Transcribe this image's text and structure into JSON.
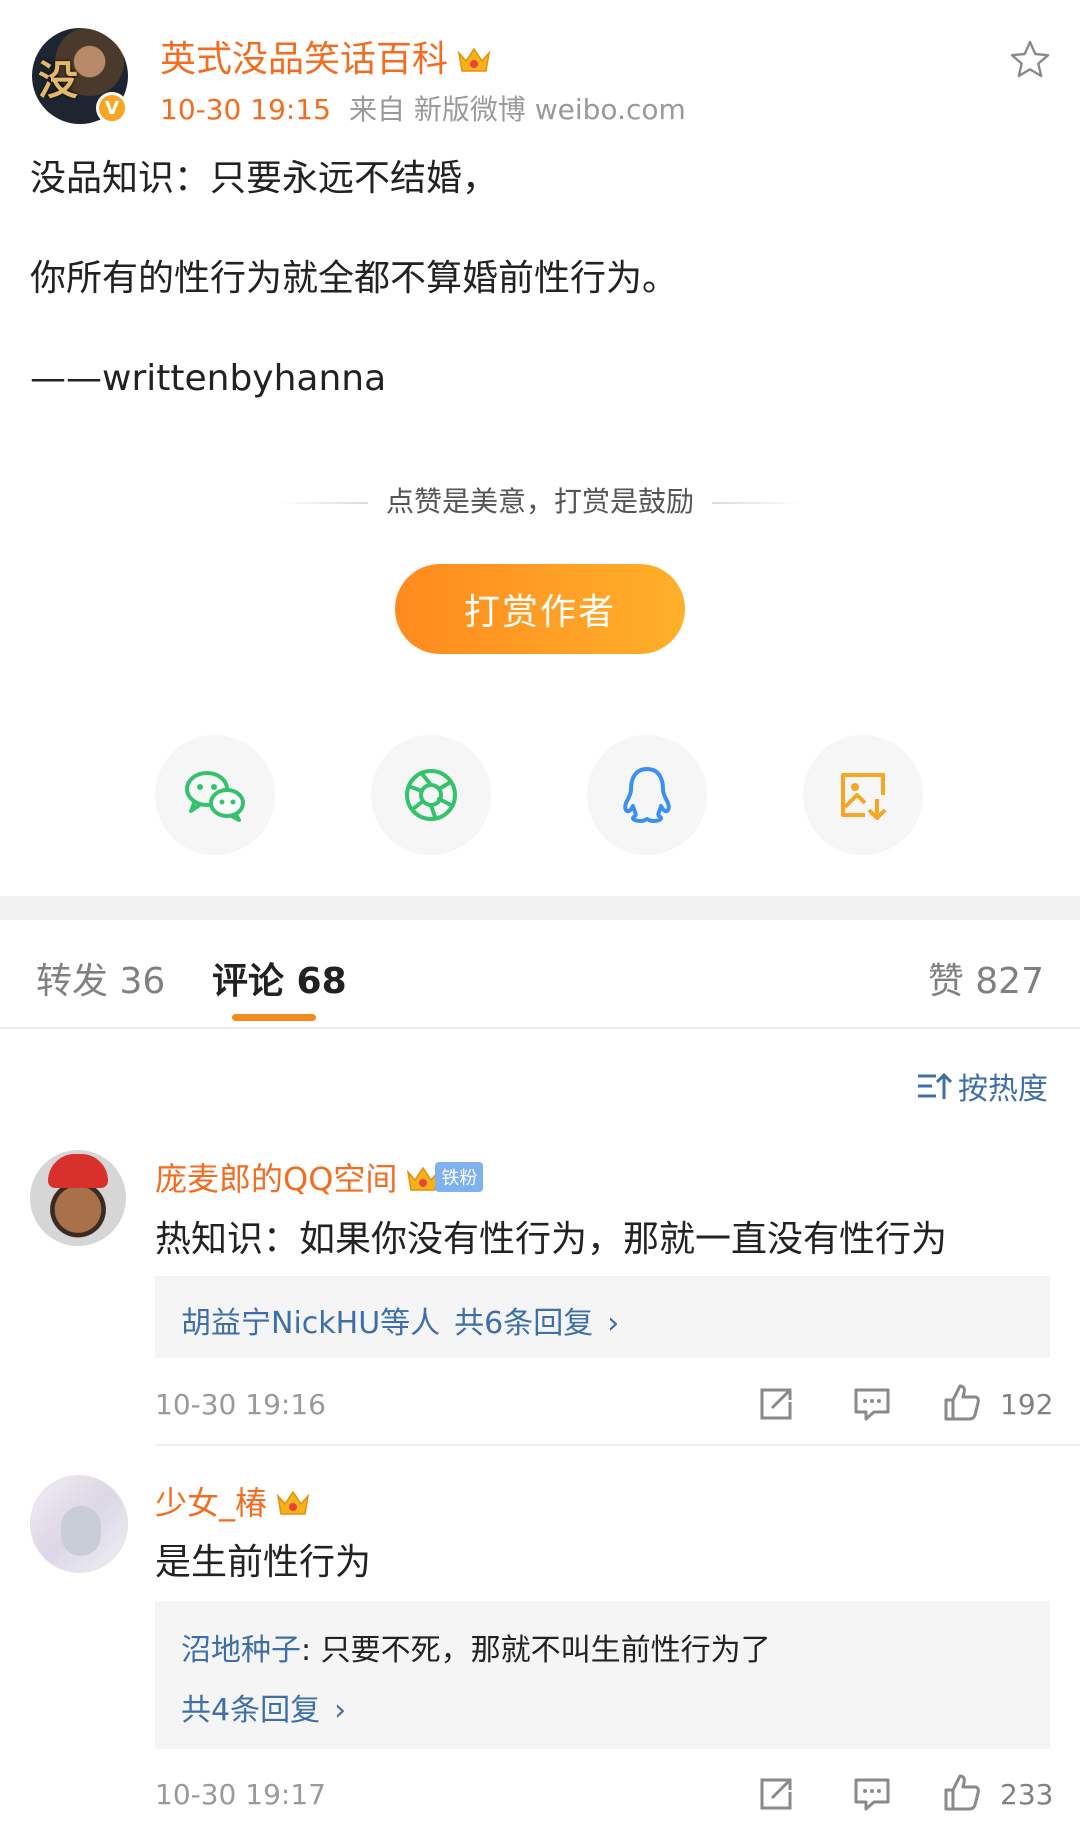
{
  "post": {
    "author": "英式没品笑话百科",
    "time": "10-30 19:15",
    "source": "来自 新版微博 weibo.com",
    "lines": [
      "没品知识：只要永远不结婚，",
      "你所有的性行为就全都不算婚前性行为。",
      "——writtenbyhanna"
    ]
  },
  "reward": {
    "hint": "点赞是美意，打赏是鼓励",
    "button": "打赏作者"
  },
  "share_icons": [
    "wechat-icon",
    "moments-icon",
    "qq-icon",
    "save-image-icon"
  ],
  "tabs": {
    "repost": "转发 36",
    "comments": "评论 68",
    "likes": "赞 827"
  },
  "sort_label": "按热度",
  "comments": [
    {
      "name": "庞麦郎的QQ空间",
      "badge": "铁粉",
      "text": "热知识：如果你没有性行为，那就一直没有性行为",
      "reply_summary_users": "胡益宁NickHU等人",
      "reply_summary_count": "共6条回复",
      "time": "10-30 19:16",
      "likes": "192"
    },
    {
      "name": "少女_椿",
      "text": "是生前性行为",
      "reply_user": "沼地种子",
      "reply_text": ": 只要不死，那就不叫生前性行为了",
      "reply_summary_count": "共4条回复",
      "time": "10-30 19:17",
      "likes": "233"
    }
  ]
}
